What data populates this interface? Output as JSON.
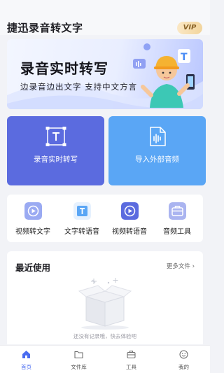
{
  "header": {
    "title": "捷迅录音转文字",
    "vip_label": "VIP"
  },
  "banner": {
    "title": "录音实时转写",
    "subtitle": "边录音边出文字 支持中文方言"
  },
  "cards": [
    {
      "label": "录音实时转写",
      "icon": "text-frame-icon",
      "color": "#5b6bdf"
    },
    {
      "label": "导入外部音频",
      "icon": "audio-file-icon",
      "color": "#5aa6f5"
    }
  ],
  "tools": [
    {
      "label": "视频转文字",
      "icon": "video-play-icon"
    },
    {
      "label": "文字转语音",
      "icon": "text-t-icon"
    },
    {
      "label": "视频转语音",
      "icon": "video-play-icon"
    },
    {
      "label": "音频工具",
      "icon": "toolbox-icon"
    }
  ],
  "recent": {
    "title": "最近使用",
    "more_label": "更多文件",
    "empty_text": "还没有记录哦，快去体验吧"
  },
  "tabbar": {
    "items": [
      {
        "label": "首页",
        "icon": "home-icon",
        "active": true
      },
      {
        "label": "文件库",
        "icon": "folder-icon",
        "active": false
      },
      {
        "label": "工具",
        "icon": "briefcase-icon",
        "active": false
      },
      {
        "label": "我的",
        "icon": "smile-icon",
        "active": false
      }
    ]
  },
  "colors": {
    "accent": "#4a6cf0",
    "card_left": "#5b6bdf",
    "card_right": "#5aa6f5",
    "vip_gold": "#f2d59d"
  }
}
